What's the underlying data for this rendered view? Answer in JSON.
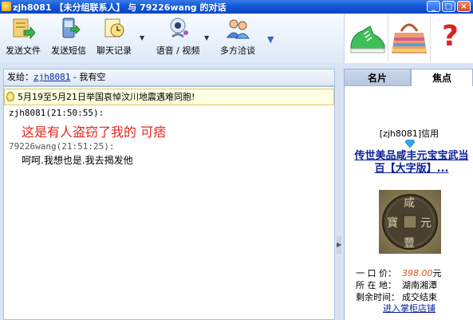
{
  "window": {
    "title": "zjh8081 【未分组联系人】 与 79226wang 的对话",
    "btn_min": "_",
    "btn_max": "□",
    "btn_close": "×"
  },
  "toolbar": {
    "send_file": "发送文件",
    "send_sms": "发送短信",
    "chat_history": "聊天记录",
    "voice_video": "语音 / 视频",
    "multi_chat": "多方洽谈",
    "dropdown_arrow": "▼",
    "more_arrow": "▼"
  },
  "ads": [
    {
      "name": "sneaker-ad",
      "icon": "green-sneaker"
    },
    {
      "name": "bag-ad",
      "icon": "striped-handbag"
    },
    {
      "name": "help-ad",
      "icon": "question-mark",
      "text": "?"
    }
  ],
  "sendto": {
    "prefix": "发给：",
    "user": "zjh8081",
    "status": " - 我有空"
  },
  "notice": "5月19至5月21日举国哀悼汶川地震遇难同胞!",
  "messages": [
    {
      "header": "zjh8081(21:50:55):",
      "body": "这是有人盗窃了我的 可痞",
      "header_color": "#000000",
      "body_color": "#e8231c"
    },
    {
      "header": "79226wang(21:51:25):",
      "body": "呵呵.我想也是.我去揭发他",
      "header_color": "#555555",
      "body_color": "#000000"
    }
  ],
  "splitter_arrow": "▶",
  "right_panel": {
    "tab_card": "名片",
    "tab_focus": "焦点",
    "credit": "[zjh8081]信用",
    "product_title": "传世美品咸丰元宝宝武当百【大字版】...",
    "coin_chars": [
      "咸",
      "豐",
      "元",
      "寶"
    ],
    "price_label": "一 口 价：",
    "price_value": "398.00",
    "price_unit": "元",
    "location_label": "所 在 地：",
    "location_value": "湖南湘潭",
    "time_label": "剩余时间：",
    "time_value": "成交结束",
    "shop_link": "进入掌柜店铺"
  }
}
